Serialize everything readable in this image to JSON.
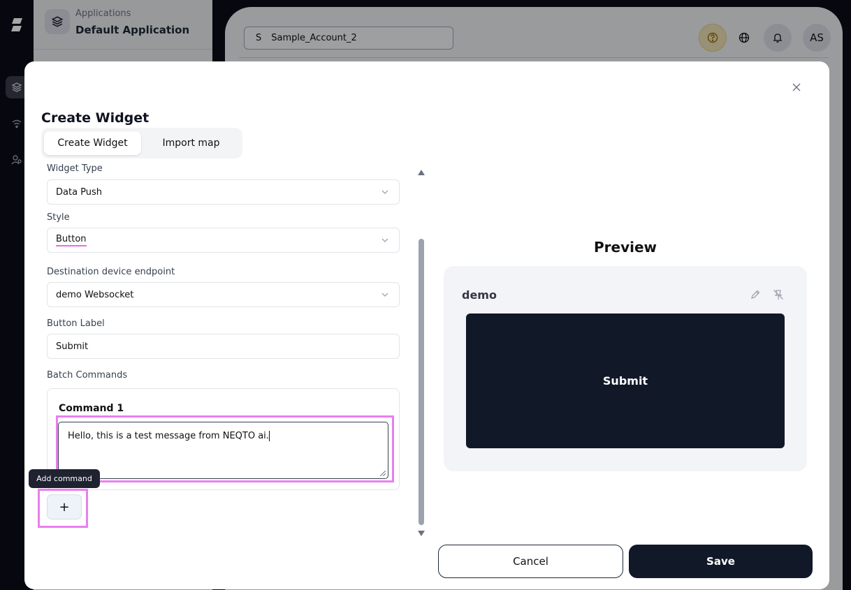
{
  "background": {
    "app_caption": "Applications",
    "app_name": "Default Application",
    "account": {
      "initial": "S",
      "name": "Sample_Account_2"
    },
    "user_initials": "AS"
  },
  "modal": {
    "title": "Create Widget",
    "tabs": [
      {
        "label": "Create Widget",
        "active": true
      },
      {
        "label": "Import map",
        "active": false
      }
    ],
    "form": {
      "widget_type": {
        "label": "Widget Type",
        "value": "Data Push"
      },
      "style": {
        "label": "Style",
        "value": "Button"
      },
      "destination": {
        "label": "Destination device endpoint",
        "value": "demo Websocket"
      },
      "button_label": {
        "label": "Button Label",
        "value": "Submit"
      },
      "batch_commands": {
        "label": "Batch Commands",
        "commands": [
          {
            "title": "Command 1",
            "value": "Hello, this is a test message from NEQTO ai."
          }
        ],
        "add_tooltip": "Add command",
        "add_symbol": "+"
      }
    },
    "preview": {
      "heading": "Preview",
      "widget_name": "demo",
      "button_text": "Submit"
    },
    "cancel_label": "Cancel",
    "save_label": "Save"
  },
  "icons": {
    "close": "close-icon",
    "chevron": "chevron-down-icon",
    "edit": "pencil-icon",
    "unpin": "pin-off-icon",
    "help": "question-icon",
    "globe": "globe-icon",
    "bell": "bell-icon"
  },
  "colors": {
    "primary": "#111827",
    "highlight": "#e87ff0",
    "preview_bg": "#f3f4f7"
  }
}
